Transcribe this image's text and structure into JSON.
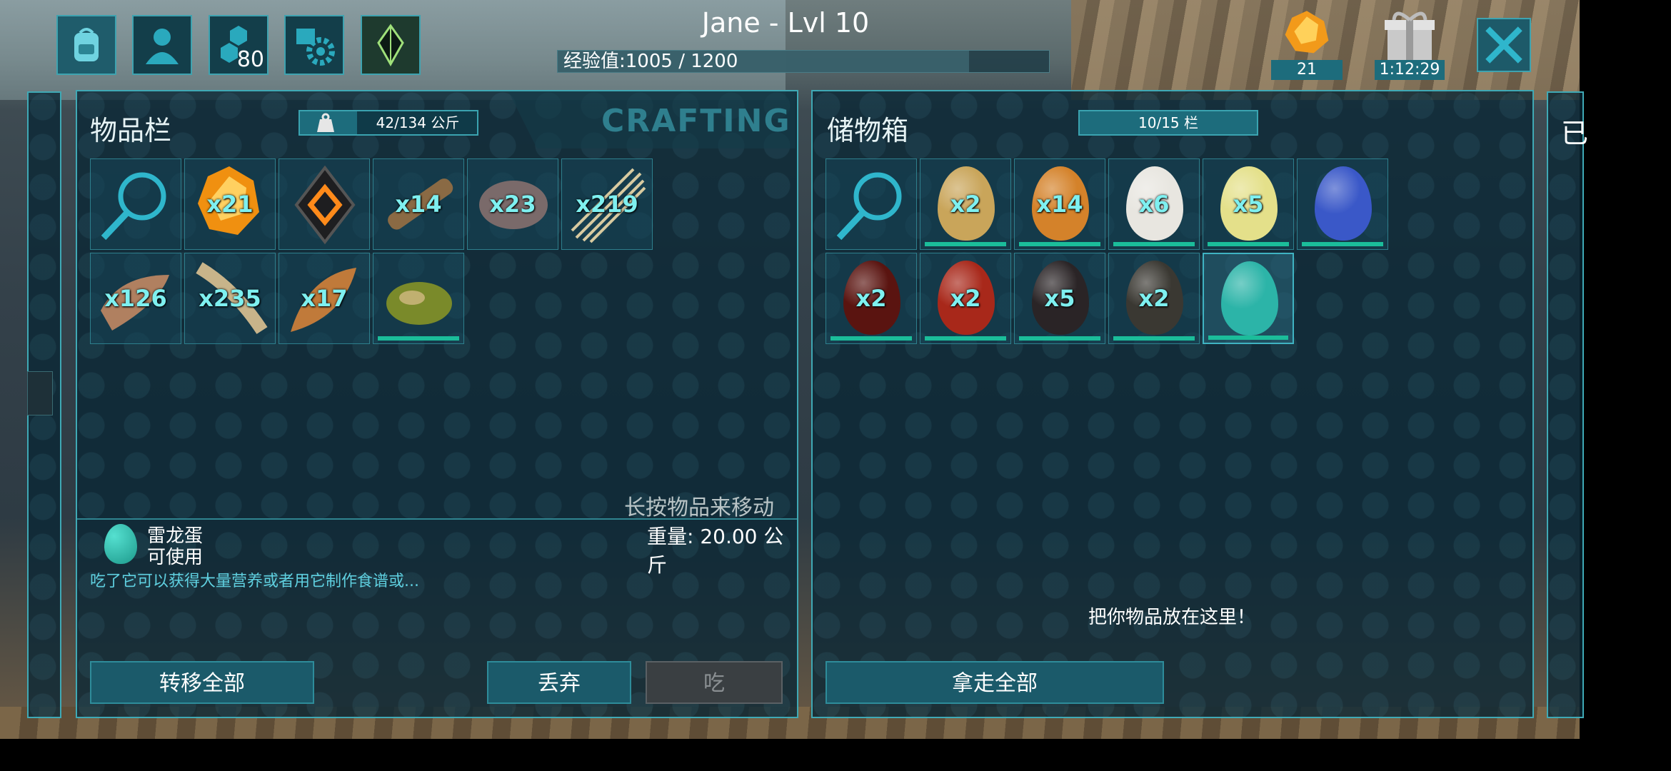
{
  "header": {
    "player_name": "Jane - Lvl 10",
    "xp_text": "经验值:1005 / 1200",
    "xp_progress": 0.8375,
    "engrams_count": "80",
    "amber_count": "21",
    "gift_timer": "1:12:29"
  },
  "inventory": {
    "title": "物品栏",
    "weight": "42/134 公斤",
    "crafting_tab": "CRAFTING",
    "items": [
      {
        "icon": "search-icon",
        "qty": ""
      },
      {
        "icon": "amber-icon",
        "qty": "x21"
      },
      {
        "icon": "implant-icon",
        "qty": ""
      },
      {
        "icon": "wood-icon",
        "qty": "x14"
      },
      {
        "icon": "stone-icon",
        "qty": "x23"
      },
      {
        "icon": "thatch-icon",
        "qty": "x219"
      },
      {
        "icon": "hide-icon",
        "qty": "x126"
      },
      {
        "icon": "fiber-icon",
        "qty": "x235"
      },
      {
        "icon": "flint-icon",
        "qty": "x17"
      },
      {
        "icon": "kibble-icon",
        "qty": ""
      }
    ],
    "hint": "长按物品来移动",
    "selected": {
      "name": "雷龙蛋",
      "status": "可使用",
      "weight": "重量: 20.00 公斤",
      "description": "吃了它可以获得大量营养或者用它制作食谱或..."
    },
    "buttons": {
      "transfer_all": "转移全部",
      "drop": "丢弃",
      "eat": "吃"
    }
  },
  "storage": {
    "title": "储物箱",
    "capacity": "10/15 栏",
    "items": [
      {
        "icon": "search-icon",
        "qty": ""
      },
      {
        "icon": "egg-icon",
        "qty": "x2",
        "color": "#c9a55a"
      },
      {
        "icon": "egg-icon",
        "qty": "x14",
        "color": "#d4822a"
      },
      {
        "icon": "egg-icon",
        "qty": "x6",
        "color": "#e8e6e0"
      },
      {
        "icon": "egg-icon",
        "qty": "x5",
        "color": "#e4e08a"
      },
      {
        "icon": "egg-icon",
        "qty": "",
        "color": "#3a58c8"
      },
      {
        "icon": "egg-icon",
        "qty": "x2",
        "color": "#5a1410"
      },
      {
        "icon": "egg-icon",
        "qty": "x2",
        "color": "#a8281a"
      },
      {
        "icon": "egg-icon",
        "qty": "x5",
        "color": "#2a2426"
      },
      {
        "icon": "egg-icon",
        "qty": "x2",
        "color": "#3a3832"
      },
      {
        "icon": "egg-icon",
        "qty": "",
        "color": "#2cb4a8"
      }
    ],
    "drop_hint": "把你物品放在这里！",
    "buttons": {
      "take_all": "拿走全部"
    }
  },
  "right_partial_label": "已"
}
